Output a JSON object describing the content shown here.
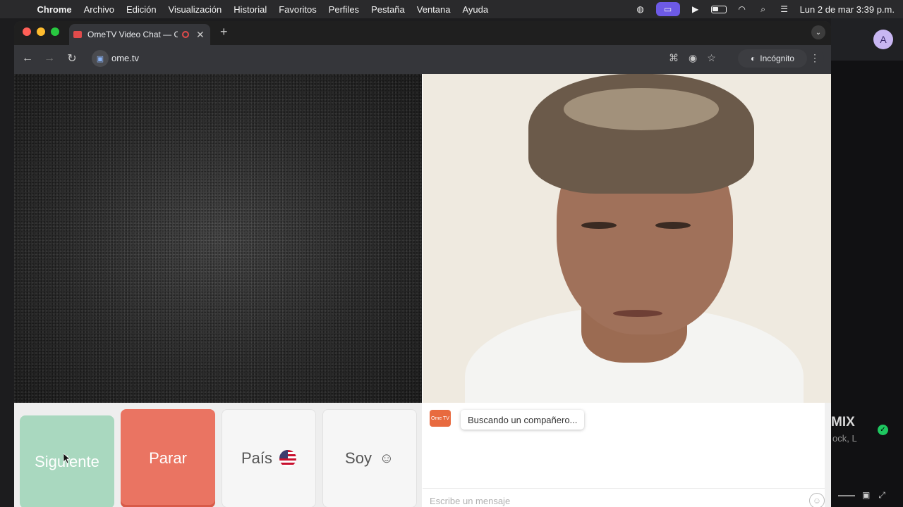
{
  "menubar": {
    "apple_icon": "apple-icon",
    "app_name": "Chrome",
    "menus": [
      "Archivo",
      "Edición",
      "Visualización",
      "Historial",
      "Favoritos",
      "Perfiles",
      "Pestaña",
      "Ventana",
      "Ayuda"
    ],
    "clock": "Lun 2 de mar  3:39 p.m."
  },
  "browser": {
    "tab_title": "OmeTV Video Chat — Om",
    "new_tab": "+",
    "url": "ome.tv",
    "incognito_label": "Incógnito"
  },
  "controls": {
    "next_label": "Siguiente",
    "stop_label": "Parar",
    "country_label": "País",
    "gender_label": "Soy",
    "colors": {
      "next": "#a9d8bf",
      "stop": "#ea7462"
    }
  },
  "chat": {
    "logo_text": "Ome TV",
    "status": "Buscando un compañero...",
    "input_placeholder": "Escribe un mensaje"
  },
  "background_window": {
    "avatar_letter": "A",
    "title_fragment": "MIX",
    "subtitle_fragment": "ock, L"
  }
}
